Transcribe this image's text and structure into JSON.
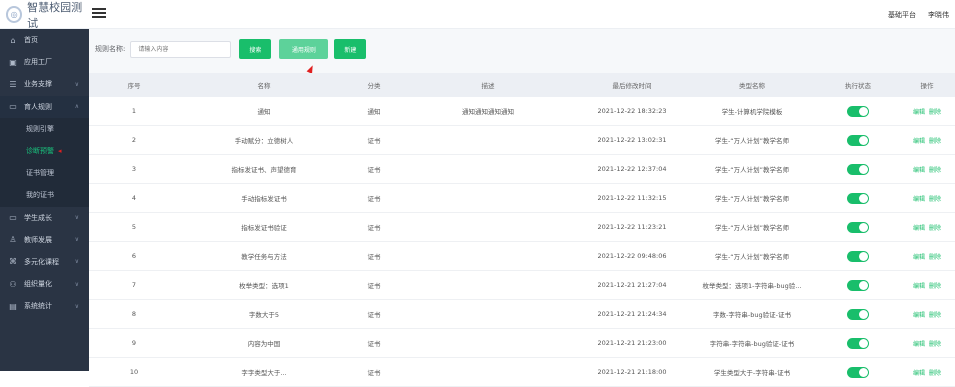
{
  "app": {
    "title": "智慧校园测试",
    "logo_icon": "school-logo"
  },
  "header": {
    "platform": "基础平台",
    "user": "李晓伟"
  },
  "sidebar": {
    "items": [
      {
        "label": "首页",
        "icon": "home-icon"
      },
      {
        "label": "应用工厂",
        "icon": "app-factory-icon"
      },
      {
        "label": "业务支撑",
        "icon": "business-icon"
      },
      {
        "label": "育人规则",
        "icon": "rules-icon"
      },
      {
        "label": "规则引擎"
      },
      {
        "label": "诊断预警"
      },
      {
        "label": "证书管理"
      },
      {
        "label": "我的证书"
      },
      {
        "label": "学生成长",
        "icon": "student-icon"
      },
      {
        "label": "教师发展",
        "icon": "teacher-icon"
      },
      {
        "label": "多元化课程",
        "icon": "course-icon"
      },
      {
        "label": "组织量化",
        "icon": "org-icon"
      },
      {
        "label": "系统统计",
        "icon": "stats-icon"
      }
    ]
  },
  "filter": {
    "label": "规则名称:",
    "placeholder": "请输入内容",
    "search_label": "搜索",
    "apply_label": "通用规则",
    "new_label": "新建"
  },
  "table": {
    "headers": [
      "序号",
      "名称",
      "分类",
      "描述",
      "最后修改时间",
      "类型名称",
      "执行状态",
      "操作"
    ],
    "edit_label": "编辑",
    "delete_label": "删除",
    "rows": [
      {
        "no": "1",
        "name": "通知",
        "category": "通知",
        "desc": "通知通知通知通知",
        "time": "2021-12-22 18:32:23",
        "type": "学生-计算机学院模板",
        "enabled": true
      },
      {
        "no": "2",
        "name": "手动赋分：立德树人",
        "category": "证书",
        "desc": "",
        "time": "2021-12-22 13:02:31",
        "type": "学生-“万人计划”教学名师",
        "enabled": true
      },
      {
        "no": "3",
        "name": "指标发证书、声望德育",
        "category": "证书",
        "desc": "",
        "time": "2021-12-22 12:37:04",
        "type": "学生-“万人计划”教学名师",
        "enabled": true
      },
      {
        "no": "4",
        "name": "手动指标发证书",
        "category": "证书",
        "desc": "",
        "time": "2021-12-22 11:32:15",
        "type": "学生-“万人计划”教学名师",
        "enabled": true
      },
      {
        "no": "5",
        "name": "指标发证书验证",
        "category": "证书",
        "desc": "",
        "time": "2021-12-22 11:23:21",
        "type": "学生-“万人计划”教学名师",
        "enabled": true
      },
      {
        "no": "6",
        "name": "教学任务与方法",
        "category": "证书",
        "desc": "",
        "time": "2021-12-22 09:48:06",
        "type": "学生-“万人计划”教学名师",
        "enabled": true
      },
      {
        "no": "7",
        "name": "枚举类型：选项1",
        "category": "证书",
        "desc": "",
        "time": "2021-12-21 21:27:04",
        "type": "枚举类型：选项1-字符串-bug验...",
        "enabled": true
      },
      {
        "no": "8",
        "name": "字数大于5",
        "category": "证书",
        "desc": "",
        "time": "2021-12-21 21:24:34",
        "type": "字数-字符串-bug验证-证书",
        "enabled": true
      },
      {
        "no": "9",
        "name": "内容为中国",
        "category": "证书",
        "desc": "",
        "time": "2021-12-21 21:23:00",
        "type": "字符串-字符串-bug验证-证书",
        "enabled": true
      },
      {
        "no": "10",
        "name": "字字类型大于...",
        "category": "证书",
        "desc": "",
        "time": "2021-12-21 21:18:00",
        "type": "学生类型大于-字符串-证书",
        "enabled": true
      }
    ]
  }
}
